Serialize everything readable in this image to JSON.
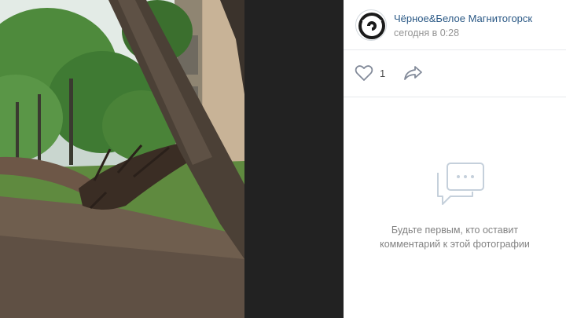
{
  "post": {
    "author": "Чёрное&Белое Магнитогорск",
    "date": "сегодня в 0:28",
    "likes": "1",
    "avatar_icon": "community-logo-icon"
  },
  "actions": {
    "like_icon": "heart-icon",
    "share_icon": "share-arrow-icon"
  },
  "comments": {
    "empty_line1": "Будьте первым, кто оставит",
    "empty_line2": "комментарий к этой фотографии",
    "empty_icon": "comments-icon"
  },
  "colors": {
    "link": "#2a5885",
    "muted": "#939393",
    "icon": "#828a99",
    "viewer_bg": "#222222",
    "accent_light": "#c5d0db"
  }
}
